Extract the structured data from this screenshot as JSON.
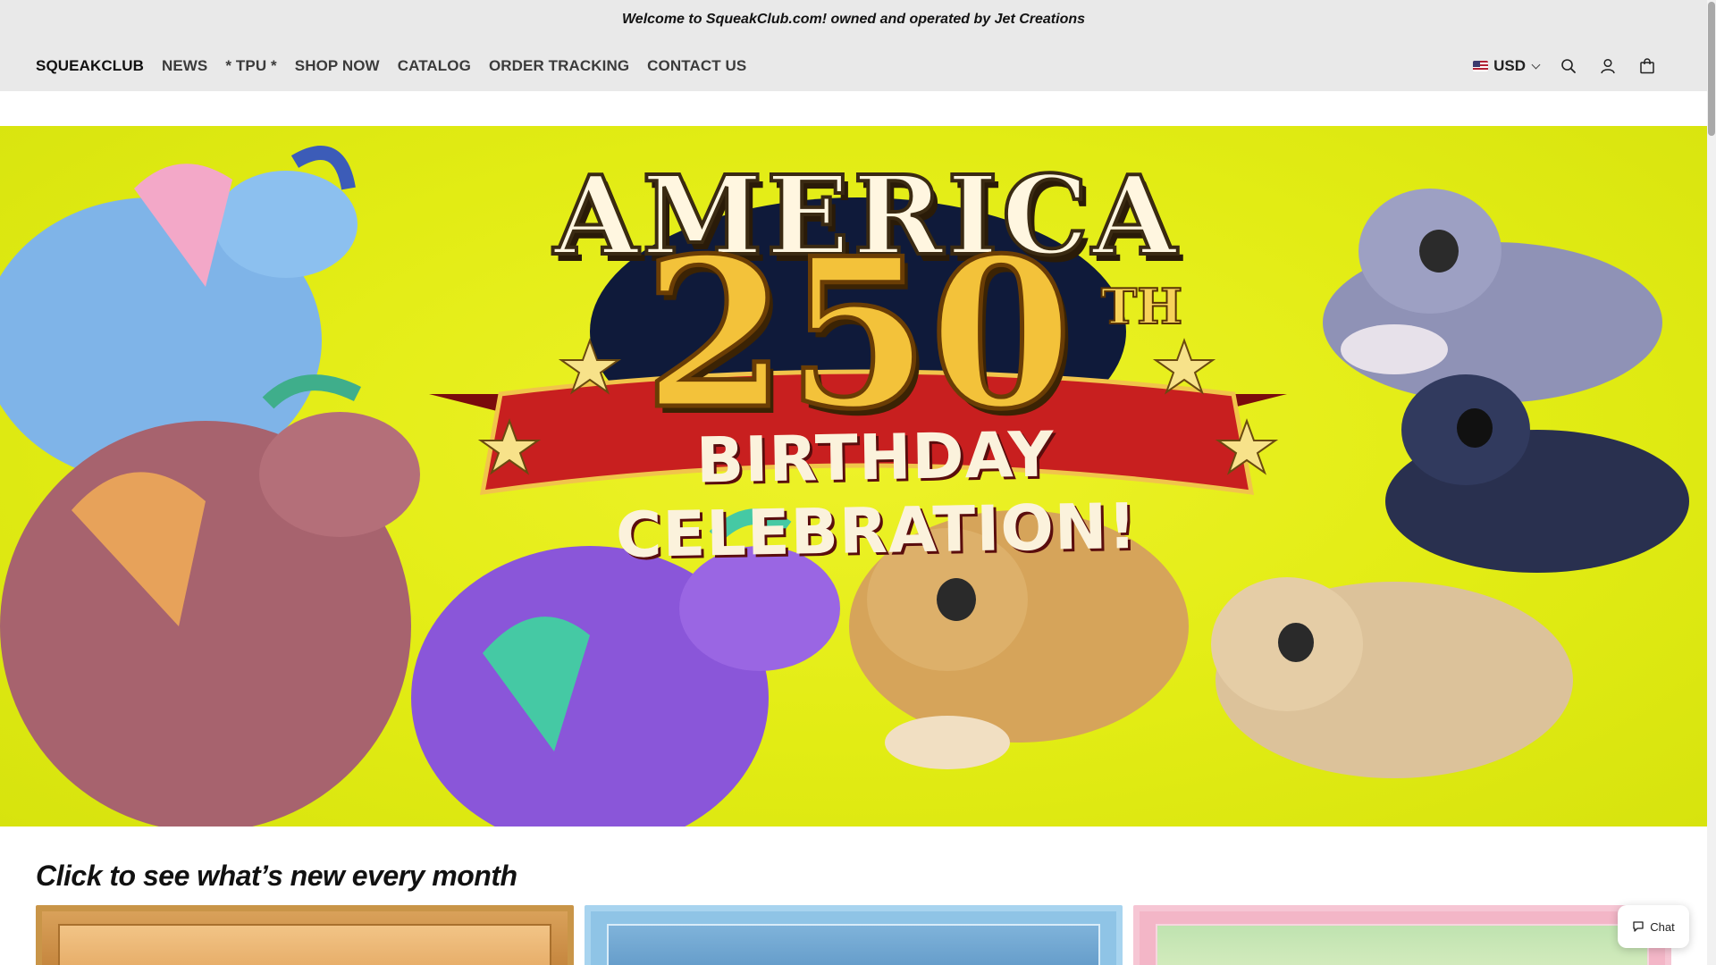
{
  "announcement": "Welcome to SqueakClub.com! owned and operated by Jet Creations",
  "nav": {
    "brand": "SQUEAKCLUB",
    "items": [
      "NEWS",
      "* TPU *",
      "SHOP NOW",
      "CATALOG",
      "ORDER TRACKING",
      "CONTACT US"
    ]
  },
  "header_right": {
    "currency": "USD",
    "icons": [
      "search-icon",
      "account-icon",
      "cart-icon"
    ]
  },
  "hero": {
    "line1": "AMERICA",
    "line2": "250",
    "suffix": "TH",
    "ribbon": "BIRTHDAY CELEBRATION!",
    "background_color": "#e2ec14"
  },
  "section": {
    "title": "Click to see what’s new every month"
  },
  "chat": {
    "label": "Chat"
  }
}
